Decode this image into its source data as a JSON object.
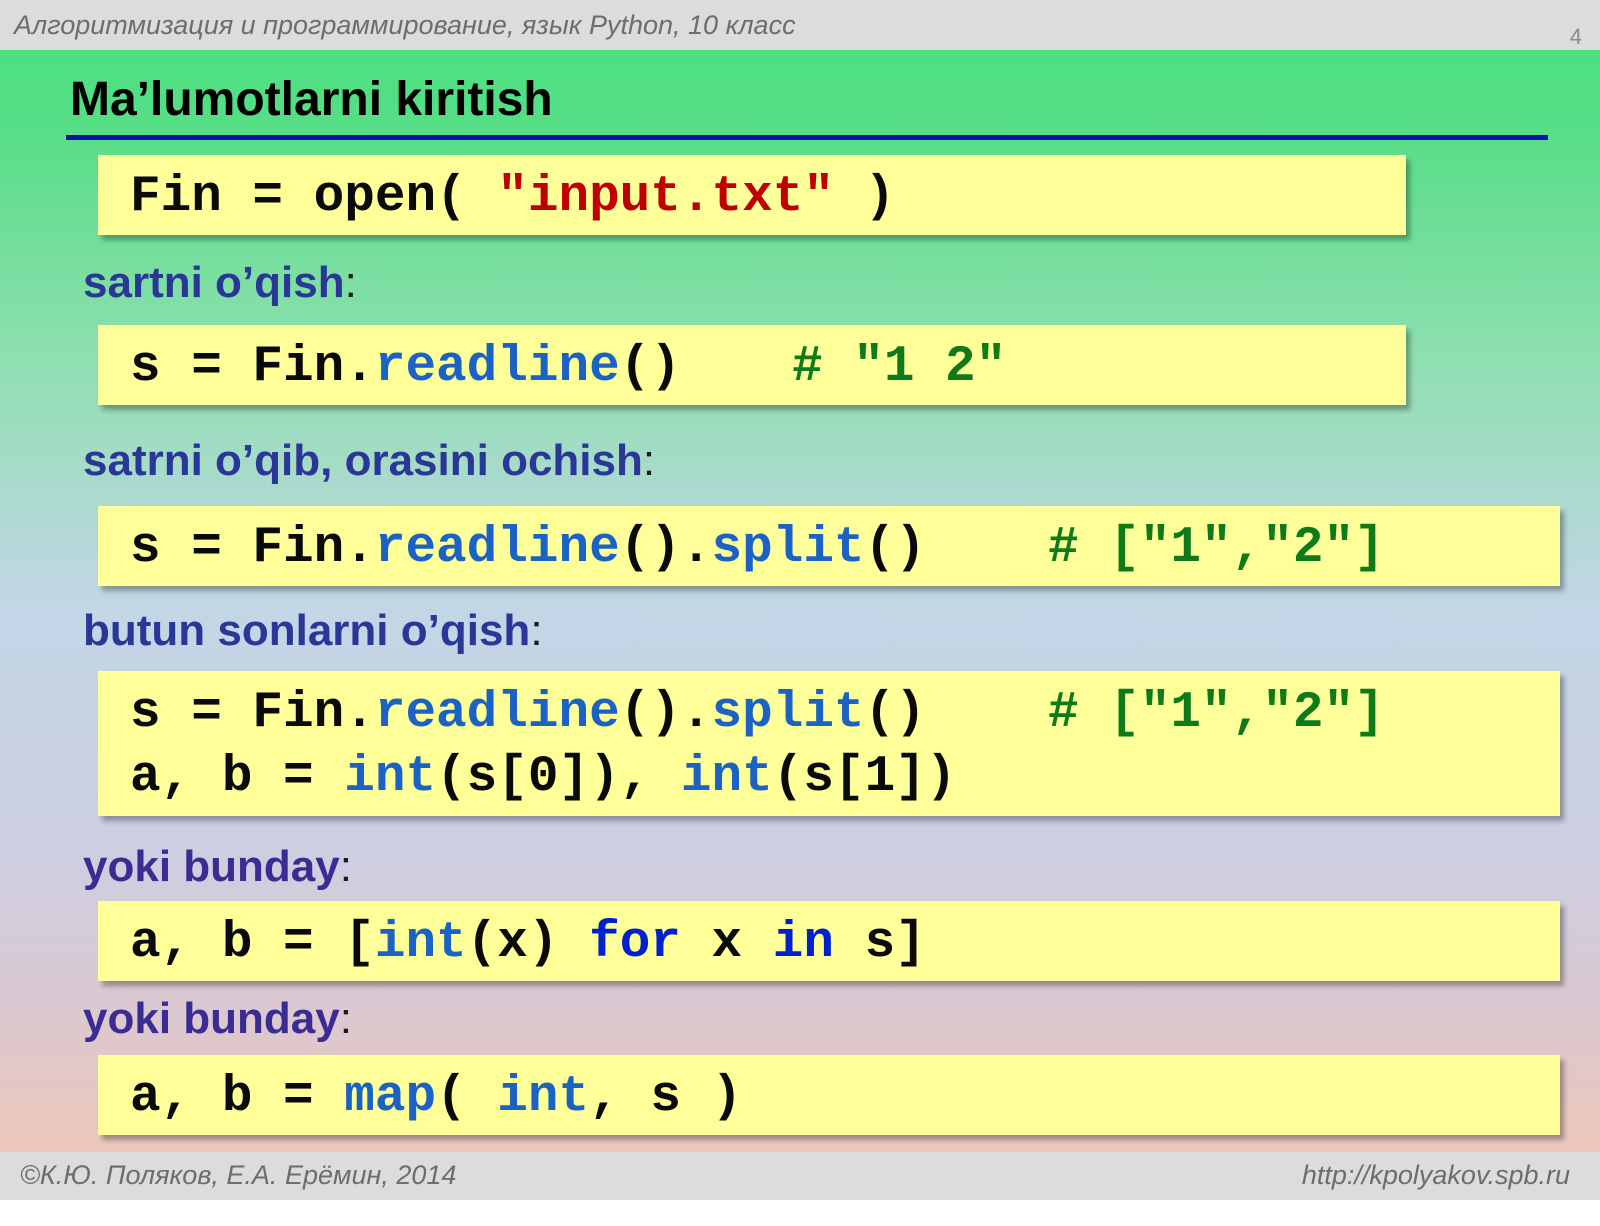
{
  "header": {
    "subject": "Алгоритмизация и программирование, язык Python, 10 класс",
    "page_number": "4"
  },
  "title": "Ma’lumotlarni kiritish",
  "sections": {
    "open": {
      "code": {
        "a": "Fin = open( ",
        "b": "\"input.txt\"",
        "c": " )"
      }
    },
    "readline": {
      "label": "sartni o’qish",
      "code": {
        "a": "s = Fin.",
        "b": "readline",
        "c": "()",
        "comment": "# \"1 2\""
      }
    },
    "split": {
      "label": "satrni o’qib, orasini ochish",
      "code": {
        "a": "s = Fin.",
        "b": "readline",
        "c": "().",
        "d": "split",
        "e": "()",
        "comment": "# [\"1\",\"2\"]"
      }
    },
    "ints": {
      "label": "butun sonlarni o’qish",
      "line1": {
        "a": "s = Fin.",
        "b": "readline",
        "c": "().",
        "d": "split",
        "e": "()",
        "comment": "# [\"1\",\"2\"]"
      },
      "line2": {
        "a": "a, b = ",
        "b": "int",
        "c": "(s[0]), ",
        "d": "int",
        "e": "(s[1])"
      }
    },
    "comprehension": {
      "label": "yoki bunday",
      "code": {
        "a": "a, b = [",
        "b": "int",
        "c": "(x) ",
        "d": "for",
        "e": " x ",
        "f": "in",
        "g": " s]"
      }
    },
    "map": {
      "label": "yoki bunday",
      "code": {
        "a": "a, b = ",
        "b": "map",
        "c": "( ",
        "d": "int",
        "e": ", s )"
      }
    }
  },
  "colon": ":",
  "footer": {
    "authors": "©К.Ю. Поляков, Е.А. Ерёмин, 2014",
    "url": "http://kpolyakov.spb.ru"
  }
}
